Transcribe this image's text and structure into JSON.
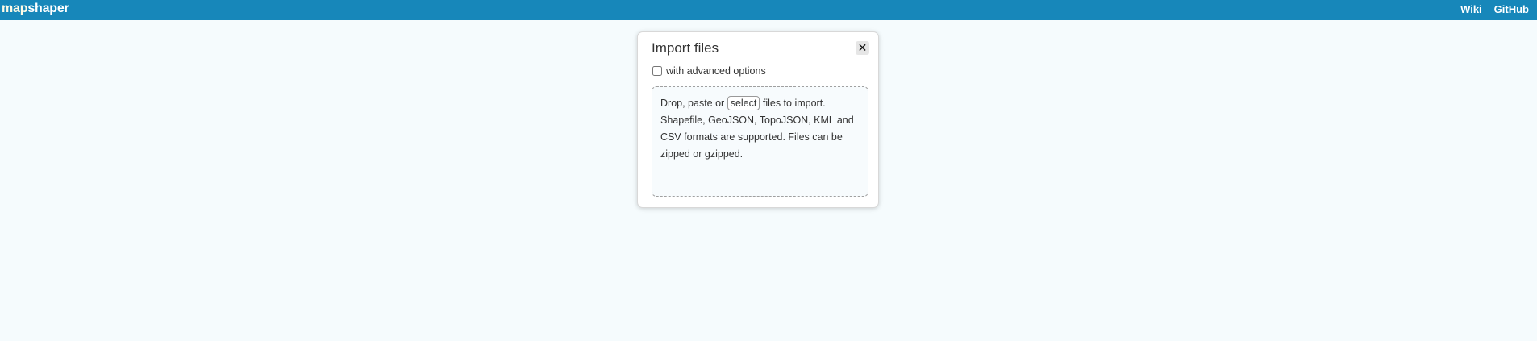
{
  "header": {
    "logo_map": "map",
    "logo_shaper": "shaper",
    "links": [
      "Wiki",
      "GitHub"
    ]
  },
  "import_dialog": {
    "title": "Import files",
    "close_label": "✕",
    "advanced_checkbox_label": "with advanced options",
    "advanced_checked": false,
    "drop_prefix": "Drop, paste or",
    "select_button": "select",
    "drop_suffix": "files to import.",
    "drop_description": "Shapefile, GeoJSON, TopoJSON, KML and CSV formats are supported. Files can be zipped or gzipped."
  },
  "colors": {
    "header_bg": "#1787ba",
    "page_bg": "#f5fbfd"
  }
}
